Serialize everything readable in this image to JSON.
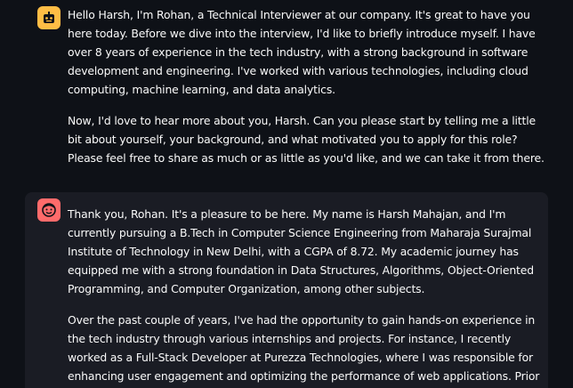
{
  "messages": [
    {
      "role": "assistant",
      "avatar_icon": "robot-face-icon",
      "avatar_color": "#ffbd45",
      "paragraphs": [
        "Hello Harsh, I'm Rohan, a Technical Interviewer at our company. It's great to have you here today. Before we dive into the interview, I'd like to briefly introduce myself. I have over 8 years of experience in the tech industry, with a strong background in software development and engineering. I've worked with various technologies, including cloud computing, machine learning, and data analytics.",
        "Now, I'd love to hear more about you, Harsh. Can you please start by telling me a little bit about yourself, your background, and what motivated you to apply for this role? Please feel free to share as much or as little as you'd like, and we can take it from there."
      ]
    },
    {
      "role": "user",
      "avatar_icon": "smiling-face-icon",
      "avatar_color": "#ff6b6b",
      "paragraphs": [
        "Thank you, Rohan. It's a pleasure to be here. My name is Harsh Mahajan, and I'm currently pursuing a B.Tech in Computer Science Engineering from Maharaja Surajmal Institute of Technology in New Delhi, with a CGPA of 8.72. My academic journey has equipped me with a strong foundation in Data Structures, Algorithms, Object-Oriented Programming, and Computer Organization, among other subjects.",
        "Over the past couple of years, I've had the opportunity to gain hands-on experience in the tech industry through various internships and projects. For instance, I recently worked as a Full-Stack Developer at Purezza Technologies, where I was responsible for enhancing user engagement and optimizing the performance of web applications. Prior to that, I interned as a"
      ]
    }
  ],
  "colors": {
    "background": "#0e1117",
    "user_message_background": "#1a1c24",
    "text": "#fafafa"
  }
}
